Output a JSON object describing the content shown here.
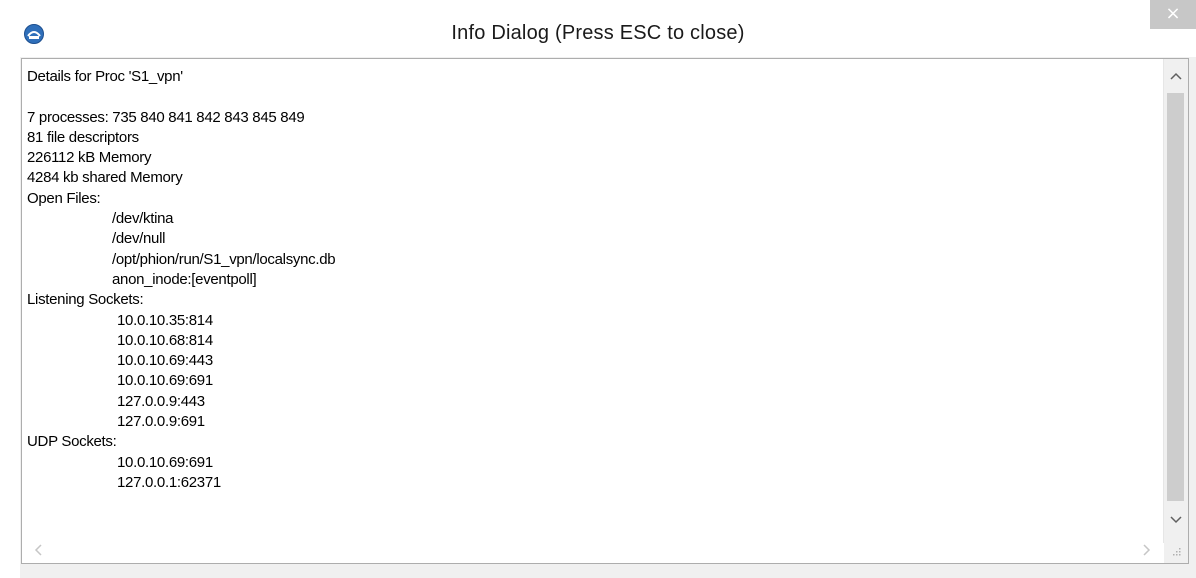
{
  "window": {
    "title": "Info Dialog (Press ESC to close)",
    "close_icon": "×",
    "accent": "#2f6fba"
  },
  "details": {
    "heading": "Details for Proc 'S1_vpn'",
    "processes": "7 processes: 735 840 841 842 843 845 849",
    "file_descriptors": "81 file descriptors",
    "memory": "226112 kB Memory",
    "shared_memory": "4284 kb shared Memory",
    "open_files_label": "Open Files:",
    "open_files": [
      "/dev/ktina",
      "/dev/null",
      "/opt/phion/run/S1_vpn/localsync.db",
      "anon_inode:[eventpoll]"
    ],
    "listening_label": "Listening Sockets:",
    "listening_sockets": [
      "10.0.10.35:814",
      "10.0.10.68:814",
      "10.0.10.69:443",
      "10.0.10.69:691",
      "127.0.0.9:443",
      "127.0.0.9:691"
    ],
    "udp_label": "UDP Sockets:",
    "udp_sockets": [
      "10.0.10.69:691",
      "127.0.0.1:62371"
    ]
  },
  "scrollbar": {
    "up_icon": "^",
    "down_icon": "v",
    "left_icon": "<",
    "right_icon": ">",
    "grip_icon": ".:"
  }
}
